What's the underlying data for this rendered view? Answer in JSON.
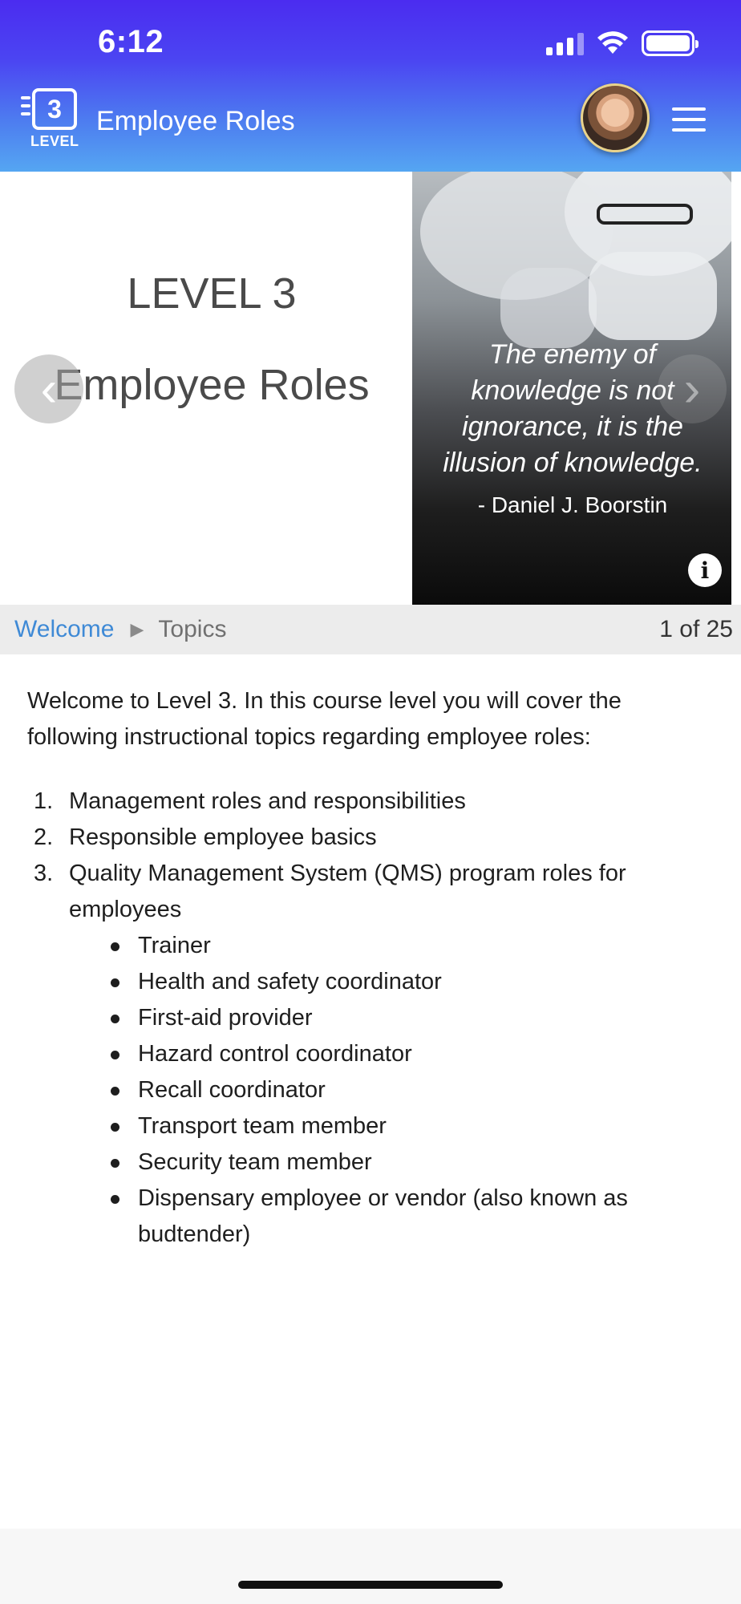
{
  "status_bar": {
    "time": "6:12"
  },
  "app_bar": {
    "logo_number": "3",
    "logo_word": "LEVEL",
    "title": "Employee Roles"
  },
  "slide": {
    "left_line1": "LEVEL 3",
    "left_line2": "Employee Roles",
    "quote": "The enemy of knowledge is not ignorance, it is the illusion of knowledge.",
    "quote_author": "- Daniel J. Boorstin",
    "info_glyph": "i"
  },
  "breadcrumb": {
    "welcome": "Welcome",
    "separator": "▶",
    "topics": "Topics",
    "page": "1 of 25"
  },
  "content": {
    "intro": "Welcome to Level 3. In this course level you will cover the following instructional topics regarding employee roles:",
    "topics": [
      {
        "num": "1.",
        "text": "Management roles and responsibilities"
      },
      {
        "num": "2.",
        "text": "Responsible employee basics"
      },
      {
        "num": "3.",
        "text": "Quality Management System (QMS) program roles for employees"
      }
    ],
    "roles": [
      "Trainer",
      "Health and safety coordinator",
      "First-aid provider",
      "Hazard control coordinator",
      "Recall coordinator",
      "Transport team member",
      "Security team member",
      "Dispensary employee or vendor (also known as budtender)"
    ]
  },
  "colors": {
    "header_top": "#4b2cf0",
    "header_bottom": "#55a6f2",
    "link": "#3f8ad6"
  }
}
